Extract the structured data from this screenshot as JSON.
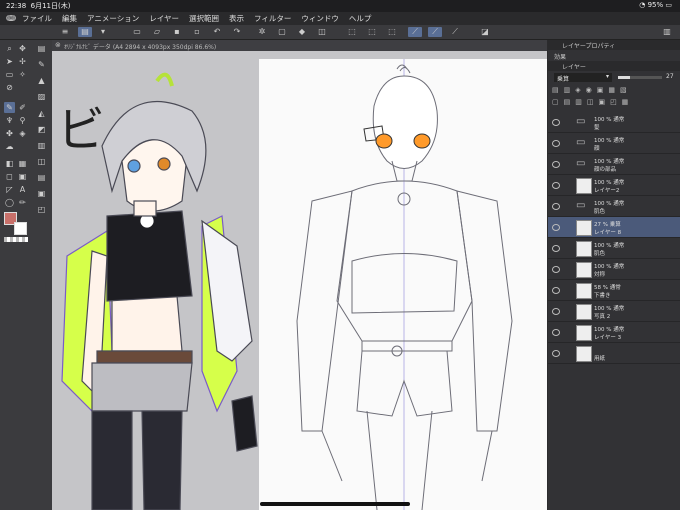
{
  "status": {
    "time": "22:38",
    "date": "6月11日(木)",
    "battery": "95%"
  },
  "menu": [
    "ファイル",
    "編集",
    "アニメーション",
    "レイヤー",
    "選択範囲",
    "表示",
    "フィルター",
    "ウィンドウ",
    "ヘルプ"
  ],
  "doc_tab": {
    "title": "ｵﾘｼﾞﾅﾙﾅﾋﾞ データ (A4 2894 x 4093px 350dpi 86.6%)"
  },
  "canvas_char": "ビ",
  "panels": {
    "property_title": "レイヤープロパティ",
    "effect_label": "効果",
    "layer_title": "レイヤー",
    "blend_mode": "乗算",
    "opacity": "27"
  },
  "layers": [
    {
      "l1": "100 % 通常",
      "l2": "髪",
      "type": "folder"
    },
    {
      "l1": "100 % 通常",
      "l2": "顔",
      "type": "folder"
    },
    {
      "l1": "100 % 通常",
      "l2": "顔の部品",
      "type": "folder"
    },
    {
      "l1": "100 % 通常",
      "l2": "レイヤー2",
      "type": "raster"
    },
    {
      "l1": "100 % 通常",
      "l2": "肌色",
      "type": "folder"
    },
    {
      "l1": "27 % 乗算",
      "l2": "レイヤー 8",
      "type": "raster",
      "selected": true
    },
    {
      "l1": "100 % 通常",
      "l2": "肌色",
      "type": "raster"
    },
    {
      "l1": "100 % 通常",
      "l2": "対称",
      "type": "raster"
    },
    {
      "l1": "58 % 通常",
      "l2": "下書き",
      "type": "raster"
    },
    {
      "l1": "100 % 通常",
      "l2": "写真 2",
      "type": "raster"
    },
    {
      "l1": "100 % 通常",
      "l2": "レイヤー 3",
      "type": "raster"
    },
    {
      "l1": "",
      "l2": "用紙",
      "type": "paper"
    }
  ],
  "colors": {
    "main": "#c8706a",
    "sub": "#ffffff",
    "selection": "#5a6f96"
  }
}
